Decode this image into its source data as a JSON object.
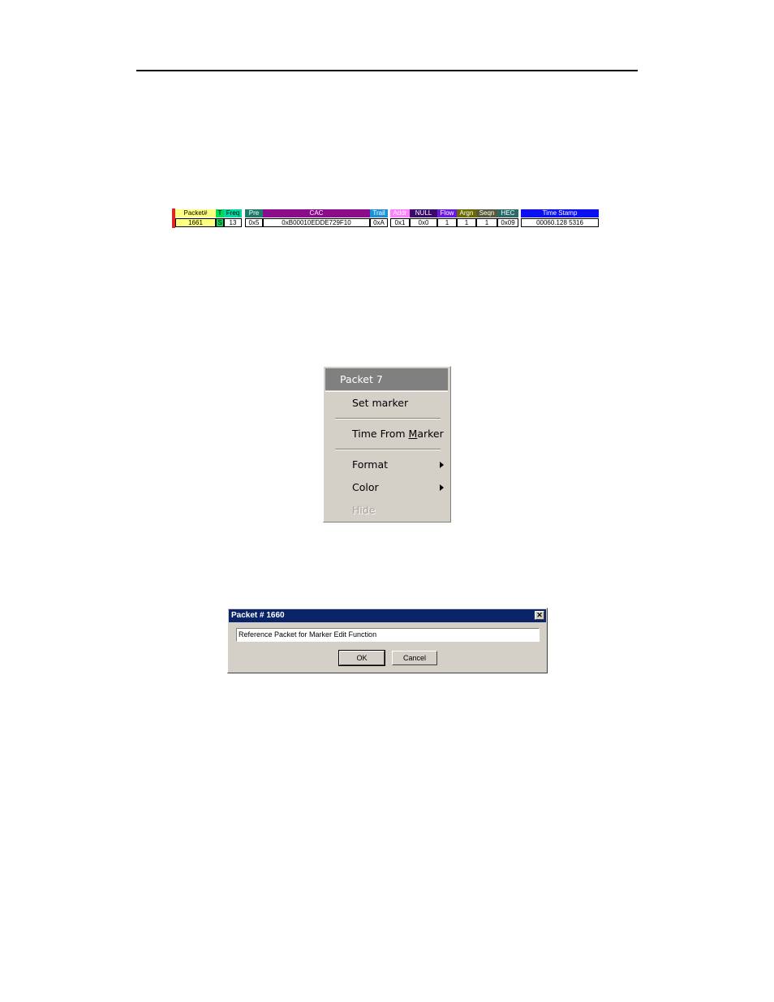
{
  "packet_strip": {
    "cells": [
      {
        "header": "Packet#",
        "value": "1661",
        "header_bg": "#ffff80",
        "header_fg": "#000000",
        "value_bg": "#ffff80"
      },
      {
        "header": "T",
        "value": "S",
        "header_bg": "#00d858",
        "header_fg": "#000000",
        "value_bg": "#00d858"
      },
      {
        "header": "Freq",
        "value": "13",
        "header_bg": "#00d8a0",
        "header_fg": "#000000",
        "value_bg": "#ffffff"
      },
      {
        "header": "Pre",
        "value": "0x5",
        "header_bg": "#1f7a6a",
        "header_fg": "#ffffff",
        "value_bg": "#ffffff"
      },
      {
        "header": "CAC",
        "value": "0xB00010EDDE729F10",
        "header_bg": "#8b0c8b",
        "header_fg": "#ffffff",
        "value_bg": "#ffffff"
      },
      {
        "header": "Trail",
        "value": "0xA",
        "header_bg": "#1e90d8",
        "header_fg": "#ffffff",
        "value_bg": "#ffffff"
      },
      {
        "header": "Addr",
        "value": "0x1",
        "header_bg": "#ff80ff",
        "header_fg": "#ffffff",
        "value_bg": "#ffffff"
      },
      {
        "header": "NULL",
        "value": "0x0",
        "header_bg": "#3a0a6a",
        "header_fg": "#ffffff",
        "value_bg": "#ffffff"
      },
      {
        "header": "Flow",
        "value": "1",
        "header_bg": "#6a1ae0",
        "header_fg": "#ffffff",
        "value_bg": "#ffffff"
      },
      {
        "header": "Argn",
        "value": "1",
        "header_bg": "#6a6a00",
        "header_fg": "#ffffff",
        "value_bg": "#ffffff"
      },
      {
        "header": "Seqn",
        "value": "1",
        "header_bg": "#5a5a3a",
        "header_fg": "#ffffff",
        "value_bg": "#ffffff"
      },
      {
        "header": "HEC",
        "value": "0x09",
        "header_bg": "#2a6a6a",
        "header_fg": "#ffffff",
        "value_bg": "#ffffff"
      },
      {
        "header": "Time Stamp",
        "value": "00060.128 5316",
        "header_bg": "#0a10f0",
        "header_fg": "#ffffff",
        "value_bg": "#ffffff"
      }
    ]
  },
  "context_menu": {
    "title": "Packet 7",
    "set_marker": "Set marker",
    "time_from_marker_pre": "Time From ",
    "time_from_marker_u": "M",
    "time_from_marker_post": "arker",
    "format": "Format",
    "color": "Color",
    "hide": "Hide"
  },
  "dialog": {
    "title": "Packet # 1660",
    "close_glyph": "✕",
    "field_value": "Reference Packet for Marker Edit Function",
    "ok_label": "OK",
    "cancel_label": "Cancel"
  }
}
